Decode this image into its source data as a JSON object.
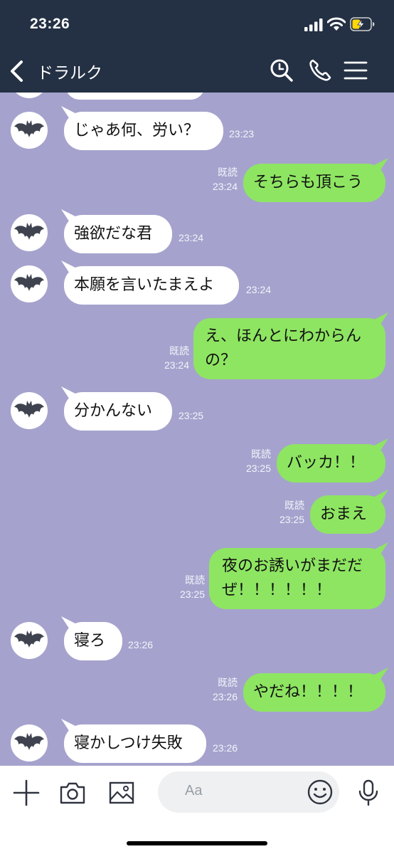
{
  "status": {
    "time": "23:26"
  },
  "header": {
    "title": "ドラルク"
  },
  "icons": {
    "back": "chevron-left-icon",
    "search": "search-icon",
    "call": "phone-icon",
    "menu": "menu-icon",
    "avatar": "bat-avatar-icon",
    "add": "plus-icon",
    "camera": "camera-icon",
    "image": "image-icon",
    "emoji": "emoji-icon",
    "mic": "mic-icon"
  },
  "colors": {
    "header_bg": "#243044",
    "chat_bg": "#a5a3cd",
    "outgoing_bubble": "#8ee562",
    "incoming_bubble": "#ffffff"
  },
  "messages": [
    {
      "dir": "in",
      "text": "じゃあ何、労い？",
      "time": "23:23"
    },
    {
      "dir": "out",
      "text": "そちらも頂こう",
      "read": "既読",
      "time": "23:24"
    },
    {
      "dir": "in",
      "text": "強欲だな君",
      "time": "23:24"
    },
    {
      "dir": "in",
      "text": "本願を言いたまえよ",
      "time": "23:24"
    },
    {
      "dir": "out",
      "text": "え、ほんとにわからんの？",
      "read": "既読",
      "time": "23:24"
    },
    {
      "dir": "in",
      "text": "分かんない",
      "time": "23:25"
    },
    {
      "dir": "out",
      "text": "バッカ！！",
      "read": "既読",
      "time": "23:25"
    },
    {
      "dir": "out",
      "text": "おまえ",
      "read": "既読",
      "time": "23:25"
    },
    {
      "dir": "out",
      "text": "夜のお誘いがまだだぜ！！！！！！",
      "read": "既読",
      "time": "23:25"
    },
    {
      "dir": "in",
      "text": "寝ろ",
      "time": "23:26"
    },
    {
      "dir": "out",
      "text": "やだね！！！！",
      "read": "既読",
      "time": "23:26"
    },
    {
      "dir": "in",
      "text": "寝かしつけ失敗",
      "time": "23:26"
    }
  ],
  "composer": {
    "placeholder": "Aa"
  }
}
